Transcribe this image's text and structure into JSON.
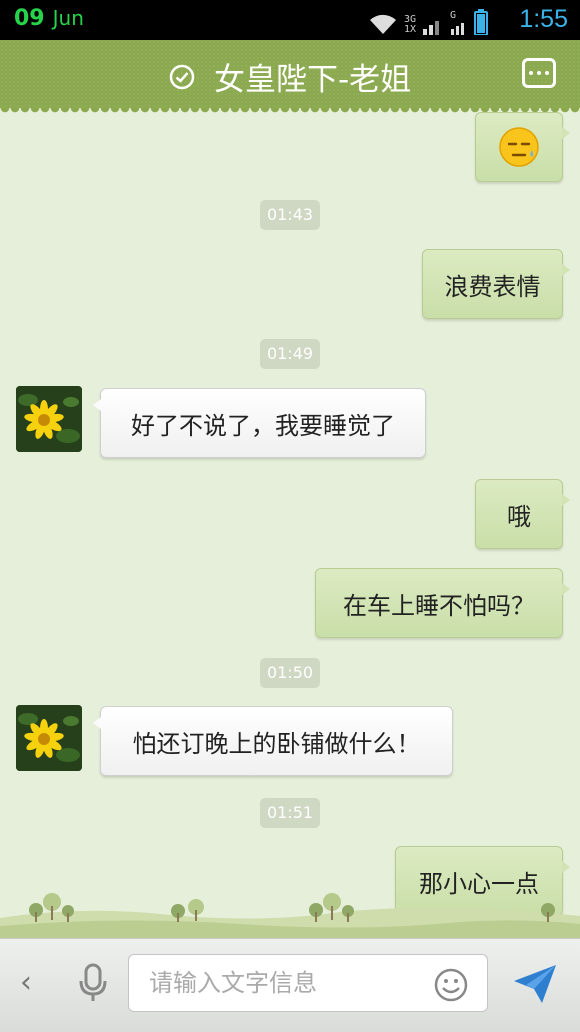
{
  "status_bar": {
    "day": "09",
    "month": "Jun",
    "network_label": "3G",
    "network_sub": "1X",
    "g_label": "G",
    "time": "1:55"
  },
  "header": {
    "title": "女皇陛下-老姐"
  },
  "messages": [
    {
      "sender": "me",
      "type": "emoji",
      "icon": "sleepy-face-icon"
    },
    {
      "type": "timestamp",
      "text": "01:43"
    },
    {
      "sender": "me",
      "text": "浪费表情"
    },
    {
      "type": "timestamp",
      "text": "01:49"
    },
    {
      "sender": "them",
      "text": "好了不说了，我要睡觉了"
    },
    {
      "sender": "me",
      "text": "哦"
    },
    {
      "sender": "me",
      "text": "在车上睡不怕吗？"
    },
    {
      "type": "timestamp",
      "text": "01:50"
    },
    {
      "sender": "them",
      "text": "怕还订晚上的卧铺做什么！"
    },
    {
      "type": "timestamp",
      "text": "01:51"
    },
    {
      "sender": "me",
      "text": "那小心一点"
    }
  ],
  "input_bar": {
    "placeholder": "请输入文字信息"
  },
  "colors": {
    "header_bg": "#8ba94f",
    "chat_bg": "#e6efd9",
    "my_bubble": "#d2e4b4",
    "their_bubble": "#ffffff",
    "time_accent": "#3bb3e8",
    "send_accent": "#2f7fd0"
  }
}
